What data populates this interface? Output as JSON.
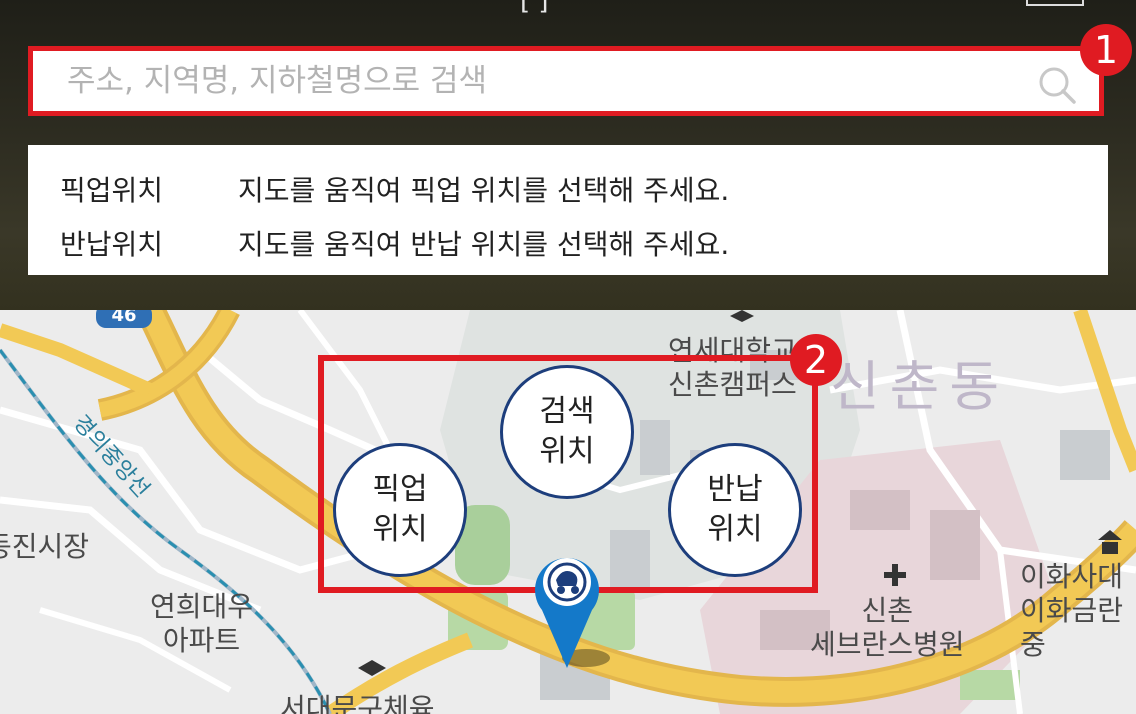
{
  "header": {
    "title_fragment": "[ ]",
    "search": {
      "placeholder": "주소, 지역명, 지하철명으로 검색",
      "value": ""
    },
    "badge_1": "1"
  },
  "info_panel": {
    "rows": [
      {
        "label": "픽업위치",
        "text": "지도를 움직여 픽업 위치를 선택해 주세요."
      },
      {
        "label": "반납위치",
        "text": "지도를 움직여 반납 위치를 선택해 주세요."
      }
    ]
  },
  "map": {
    "badge_2": "2",
    "buttons": {
      "search_location": [
        "검색",
        "위치"
      ],
      "pickup_location": [
        "픽업",
        "위치"
      ],
      "return_location": [
        "반납",
        "위치"
      ]
    },
    "labels": {
      "campus_1": "연세대학교",
      "campus_2": "신촌캠퍼스",
      "district": "신촌동",
      "subway_line": "경의중앙선",
      "market": "동진시장",
      "apartment_1": "연희대우",
      "apartment_2": "아파트",
      "hospital_1": "신촌",
      "hospital_2": "세브란스병원",
      "ewha_1": "이화사대",
      "ewha_2": "이화금란중",
      "sports": "서대문구체육",
      "road_number": "46"
    }
  },
  "colors": {
    "accent_red": "#e01b22",
    "circle_border": "#1d3e7c",
    "pin_blue": "#1479c9",
    "road_yellow": "#f2c955"
  }
}
